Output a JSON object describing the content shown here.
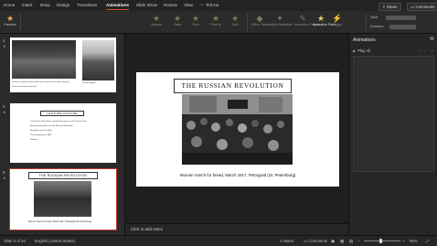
{
  "ribbon_tabs": [
    {
      "label": "Home",
      "active": false
    },
    {
      "label": "Insert",
      "active": false
    },
    {
      "label": "Draw",
      "active": false
    },
    {
      "label": "Design",
      "active": false
    },
    {
      "label": "Transitions",
      "active": false
    },
    {
      "label": "Animations",
      "active": true
    },
    {
      "label": "Slide Show",
      "active": false
    },
    {
      "label": "Review",
      "active": false
    },
    {
      "label": "View",
      "active": false
    },
    {
      "label": "Recording",
      "active": false
    }
  ],
  "tell_me": "Tell me",
  "share_label": "Share",
  "comments_label": "Comments",
  "ribbon": {
    "preview_label": "Preview",
    "effects": [
      "Appear",
      "Fade",
      "Fly In",
      "Float In",
      "Split",
      "Wipe",
      "Shape",
      "Wheel",
      "Random Bars"
    ],
    "effect_options_label": "Effect Options",
    "add_animation_label": "Add Animation",
    "animation_pane_label": "Animation Pane",
    "trigger_label": "Trigger",
    "reorder_label": "Animation Painter",
    "start_label": "Start:",
    "duration_label": "Duration:"
  },
  "thumbnails": [
    {
      "number": "4",
      "star": "★",
      "caption_left": "View on a large Demonstration which spread from Tageszeitung ...",
      "caption_left2": "Where do we go from here?",
      "caption_right": "Portrait caption"
    },
    {
      "number": "5",
      "star": "★",
      "heading": "LECTURE OUTLINE",
      "bullets": [
        "The Russian Revolution and the Emergence of the Soviet Union",
        "Revolutionary Ideas and the Russian Revolution",
        "Revolution and Civil War",
        "The Introduction of NEP",
        "Stalinism"
      ]
    },
    {
      "number": "6",
      "star": "★",
      "heading": "THE RUSSIAN REVOLUTION",
      "caption": "Women march for bread, March 1917, Petrograd (St. Petersburg)"
    }
  ],
  "slide": {
    "title": "THE RUSSIAN REVOLUTION",
    "caption": "Women march for bread, March 1917, Petrograd (St. Petersburg)"
  },
  "notes_placeholder": "Click to add notes",
  "animation_pane": {
    "title": "Animations",
    "play_label": "Play All"
  },
  "status": {
    "slide_info": "Slide 6 of 20",
    "language": "English (United States)",
    "notes_label": "Notes",
    "comments_label": "Comments",
    "zoom": "95%",
    "zoom_level": 0.45
  },
  "colors": {
    "accent": "#d35230",
    "selection": "#c0392b"
  }
}
